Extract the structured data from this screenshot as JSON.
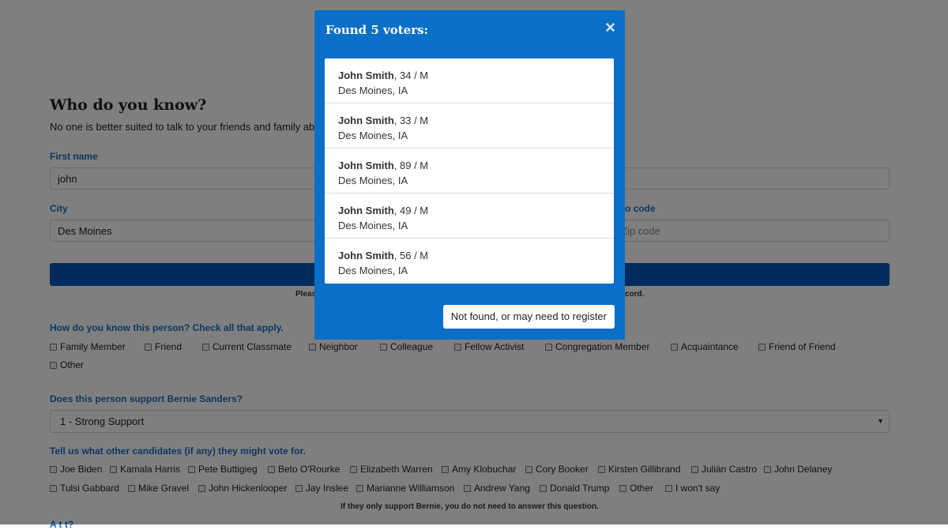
{
  "form": {
    "heading": "Who do you know?",
    "intro": "No one is better suited to talk to your friends and family about o",
    "first_name_label": "First name",
    "first_name_value": "john",
    "city_label": "City",
    "city_value": "Des Moines",
    "zip_label": "o code",
    "zip_placeholder": "Zip code",
    "help_left": "Pleas",
    "help_right": "cord.",
    "relationship_question": "How do you know this person? Check all that apply.",
    "relationships": [
      "Family Member",
      "Friend",
      "Current Classmate",
      "Neighbor",
      "Colleague",
      "Fellow Activist",
      "Congregation Member",
      "Acquaintance",
      "Friend of Friend",
      "Other"
    ],
    "support_question": "Does this person support Bernie Sanders?",
    "support_value": "1 - Strong Support",
    "candidates_question": "Tell us what other candidates (if any) they might vote for.",
    "candidates": [
      "Joe Biden",
      "Kamala Harris",
      "Pete Buttigieg",
      "Beto O'Rourke",
      "Elizabeth Warren",
      "Amy Klobuchar",
      "Cory Booker",
      "Kirsten Gillibrand",
      "Julián Castro",
      "John Delaney",
      "Tulsi Gabbard",
      "Mike Gravel",
      "John Hickenlooper",
      "Jay Inslee",
      "Marianne Williamson",
      "Andrew Yang",
      "Donald Trump",
      "Other",
      "I won't say"
    ],
    "candidates_note": "If they only support Bernie, you do not need to answer this question.",
    "next_question_cut": "A         t t? "
  },
  "modal": {
    "title": "Found 5 voters:",
    "close_label": "×",
    "results": [
      {
        "name": "John Smith",
        "detail": ", 34 / M",
        "location": "Des Moines, IA"
      },
      {
        "name": "John Smith",
        "detail": ", 33 / M",
        "location": "Des Moines, IA"
      },
      {
        "name": "John Smith",
        "detail": ", 89 / M",
        "location": "Des Moines, IA"
      },
      {
        "name": "John Smith",
        "detail": ", 49 / M",
        "location": "Des Moines, IA"
      },
      {
        "name": "John Smith",
        "detail": ", 56 / M",
        "location": "Des Moines, IA"
      }
    ],
    "not_found_label": "Not found, or may need to register"
  },
  "colors": {
    "accent": "#1c6fbf",
    "modal_bg": "#0a6fc7",
    "button_bg": "#0057b8"
  }
}
